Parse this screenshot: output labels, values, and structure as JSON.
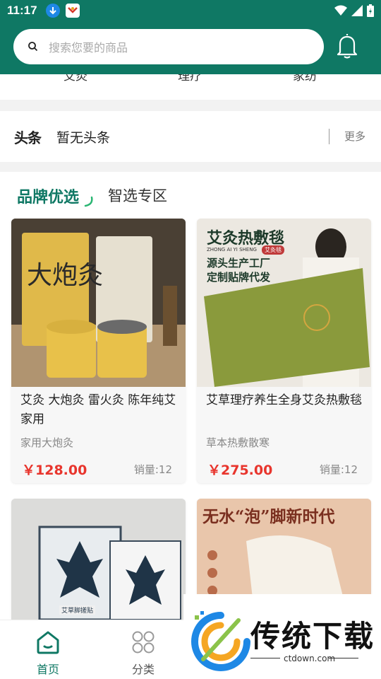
{
  "status_bar": {
    "time": "11:17"
  },
  "search": {
    "placeholder": "搜索您要的商品"
  },
  "category_strip": [
    "艾灸",
    "理疗",
    "家纺"
  ],
  "headline": {
    "logo_main": "头条",
    "text": "暂无头条",
    "more": "更多"
  },
  "brand_section": {
    "active_tab": "品牌优选",
    "other_tab": "智选专区"
  },
  "products": [
    {
      "title": "艾灸 大炮灸 雷火灸 陈年纯艾 家用",
      "subtitle": "家用大炮灸",
      "price": "￥128.00",
      "sales": "销量:12"
    },
    {
      "title": "艾草理疗养生全身艾灸热敷毯",
      "subtitle": "草本热敷散寒",
      "price": "￥275.00",
      "sales": "销量:12",
      "image_text": {
        "heading": "艾灸热敷毯",
        "pinyin": "ZHONG AI YI SHENG",
        "badge": "艾灸毯",
        "line1": "源头生产工厂",
        "line2": "定制贴牌代发"
      }
    },
    {
      "image_text": {
        "label": "艾草脚搓贴"
      }
    },
    {
      "image_text": {
        "heading": "无水“泡”脚新时代"
      }
    }
  ],
  "tabbar": [
    {
      "label": "首页",
      "active": true
    },
    {
      "label": "分类",
      "active": false
    }
  ],
  "watermark": {
    "title": "传统下载",
    "url": "ctdown.com"
  },
  "colors": {
    "primary": "#0f7864",
    "price": "#e8352d",
    "swoosh": "#2bb673"
  }
}
